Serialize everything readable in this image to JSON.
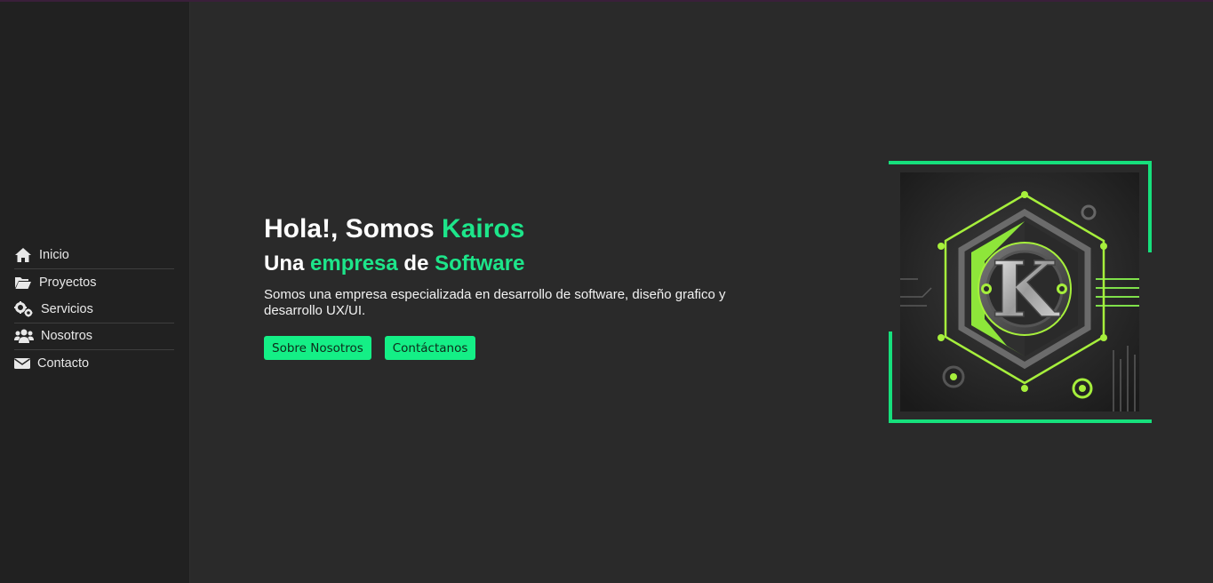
{
  "nav": {
    "items": [
      {
        "label": "Inicio",
        "icon": "home-icon"
      },
      {
        "label": "Proyectos",
        "icon": "folder-open-icon"
      },
      {
        "label": "Servicios",
        "icon": "gears-icon"
      },
      {
        "label": "Nosotros",
        "icon": "users-icon"
      },
      {
        "label": "Contacto",
        "icon": "envelope-icon"
      }
    ]
  },
  "hero": {
    "title_prefix": "Hola!, Somos ",
    "title_accent": "Kairos",
    "subtitle_part1": "Una ",
    "subtitle_accent1": "empresa",
    "subtitle_part2": " de ",
    "subtitle_accent2": "Software",
    "description": "Somos una empresa especializada en desarrollo de software, diseño grafico y desarrollo UX/UI.",
    "buttons": {
      "about_label": "Sobre Nosotros",
      "contact_label": "Contáctanos"
    }
  },
  "logo": {
    "letter": "K"
  },
  "colors": {
    "accent": "#1de58a",
    "button": "#14ef86",
    "background": "#2a2a2a",
    "sidebar": "#212121"
  }
}
